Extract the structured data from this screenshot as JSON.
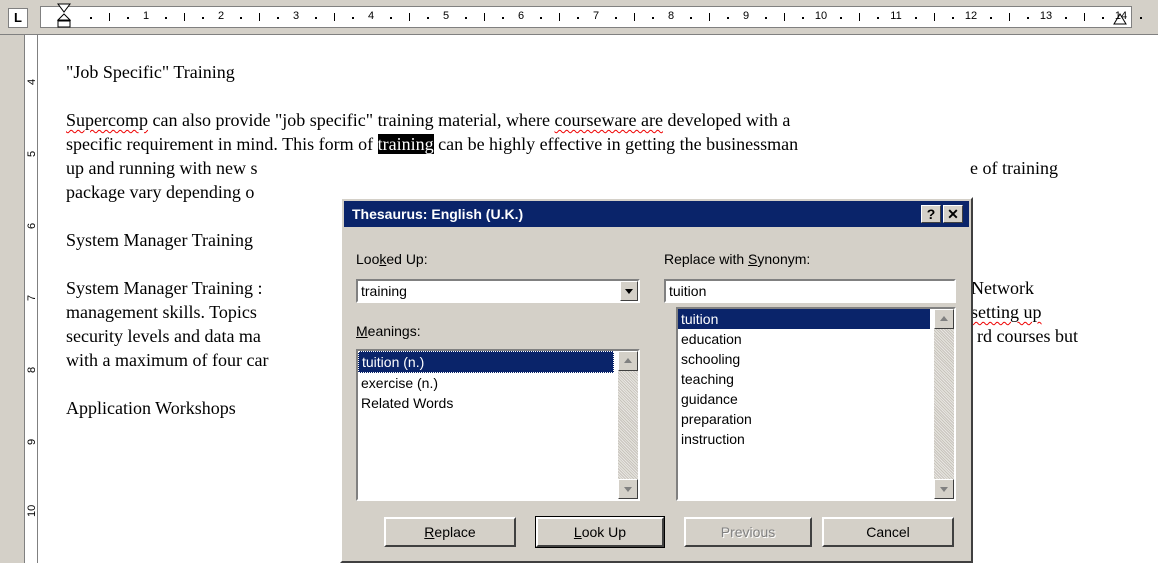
{
  "ruler": {
    "tab_selector": "L",
    "numbers": [
      "1",
      "2",
      "3",
      "4",
      "5",
      "6",
      "7",
      "8",
      "9",
      "10",
      "11",
      "12",
      "13",
      "14"
    ],
    "vertical_numbers": [
      "4",
      "5",
      "6",
      "7",
      "8",
      "9",
      "10"
    ]
  },
  "document": {
    "heading1": "\"Job Specific\" Training",
    "para1": {
      "line1_a": "Supercomp",
      "line1_b": " can also provide \"job specific\" training material, where ",
      "line1_c": "courseware are",
      "line1_d": " developed with a",
      "line2_a": "specific requirement in mind.  This form of ",
      "line2_sel": "training",
      "line2_b": " can be highly effective in getting the businessman",
      "line3_a": "up and running with new s",
      "line3_b": "e of training",
      "line4_a": "package vary depending o"
    },
    "heading2": "System Manager Training",
    "para2": {
      "line1_a": "System Manager Training :",
      "line1_b": "Network",
      "line2_a": "management skills.  Topics",
      "line2_b": "setting up",
      "line3_a": "security levels and data ma",
      "line3_b": "rd courses but",
      "line4_a": "with a maximum of four car"
    },
    "heading3": "Application Workshops"
  },
  "dialog": {
    "title": "Thesaurus: English (U.K.)",
    "help_label": "?",
    "close_label": "✕",
    "looked_up_label_pre": "Loo",
    "looked_up_label_key": "k",
    "looked_up_label_post": "ed Up:",
    "looked_up_value": "training",
    "meanings_label_key": "M",
    "meanings_label_post": "eanings:",
    "meanings": [
      "tuition (n.)",
      "exercise (n.)",
      "Related Words"
    ],
    "replace_label_pre": "Replace with ",
    "replace_label_key": "S",
    "replace_label_post": "ynonym:",
    "replace_value": "tuition",
    "synonyms": [
      "tuition",
      "education",
      "schooling",
      "teaching",
      "guidance",
      "preparation",
      "instruction"
    ],
    "buttons": {
      "replace_key": "R",
      "replace_post": "eplace",
      "lookup_key": "L",
      "lookup_post": "ook Up",
      "previous": "Previous",
      "cancel": "Cancel"
    }
  }
}
